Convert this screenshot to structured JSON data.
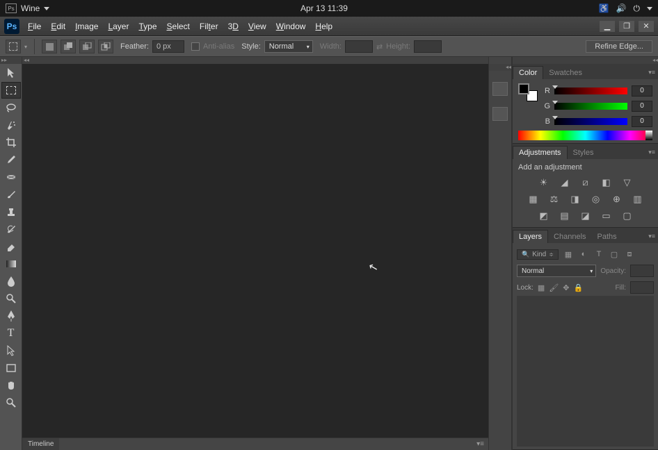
{
  "os": {
    "app_name": "Wine",
    "clock": "Apr 13  11:39"
  },
  "menubar": [
    "File",
    "Edit",
    "Image",
    "Layer",
    "Type",
    "Select",
    "Filter",
    "3D",
    "View",
    "Window",
    "Help"
  ],
  "options": {
    "feather_label": "Feather:",
    "feather_value": "0 px",
    "antialias": "Anti-alias",
    "style_label": "Style:",
    "style_value": "Normal",
    "width_label": "Width:",
    "height_label": "Height:",
    "refine": "Refine Edge..."
  },
  "timeline": {
    "tab": "Timeline"
  },
  "panels": {
    "color": {
      "tabs": [
        "Color",
        "Swatches"
      ],
      "channels": [
        {
          "label": "R",
          "value": "0"
        },
        {
          "label": "G",
          "value": "0"
        },
        {
          "label": "B",
          "value": "0"
        }
      ]
    },
    "adjust": {
      "tabs": [
        "Adjustments",
        "Styles"
      ],
      "hint": "Add an adjustment"
    },
    "layers": {
      "tabs": [
        "Layers",
        "Channels",
        "Paths"
      ],
      "kind": "Kind",
      "blend": "Normal",
      "opacity_label": "Opacity:",
      "lock_label": "Lock:",
      "fill_label": "Fill:"
    }
  }
}
